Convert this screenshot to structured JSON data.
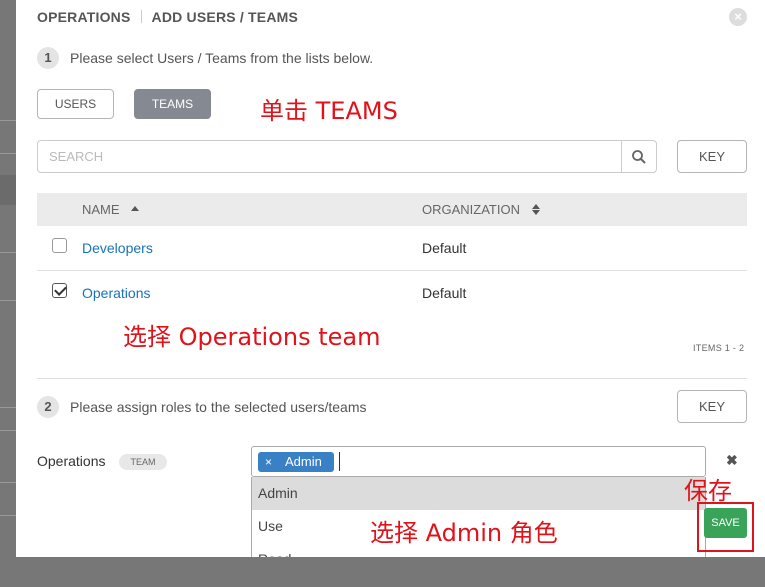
{
  "header": {
    "breadcrumb_parent": "OPERATIONS",
    "title": "ADD USERS / TEAMS"
  },
  "step1": {
    "number": "1",
    "text": "Please select Users / Teams from the lists below."
  },
  "toggle": {
    "users_label": "USERS",
    "teams_label": "TEAMS",
    "active": "TEAMS"
  },
  "search": {
    "placeholder": "SEARCH",
    "key_label": "KEY"
  },
  "table": {
    "columns": [
      "NAME",
      "ORGANIZATION"
    ],
    "rows": [
      {
        "name": "Developers",
        "organization": "Default",
        "checked": false
      },
      {
        "name": "Operations",
        "organization": "Default",
        "checked": true
      }
    ],
    "items_label": "ITEMS  1 - 2"
  },
  "step2": {
    "number": "2",
    "text": "Please assign roles to the selected users/teams",
    "key_label": "KEY"
  },
  "assignment": {
    "name": "Operations",
    "type": "TEAM",
    "selected_roles": [
      "Admin"
    ],
    "remove_symbol": "×",
    "options": [
      "Admin",
      "Use",
      "Read"
    ],
    "highlighted_option": "Admin"
  },
  "save_label": "SAVE",
  "annotations": {
    "click_teams": "单击 TEAMS",
    "choose_team": "选择 Operations team",
    "choose_role": "选择 Admin 角色",
    "save": "保存"
  },
  "colors": {
    "annotation": "#e0121a",
    "link": "#1a72b8",
    "chip": "#3a80c4",
    "save": "#3aa35a",
    "active_toggle": "#848992"
  }
}
